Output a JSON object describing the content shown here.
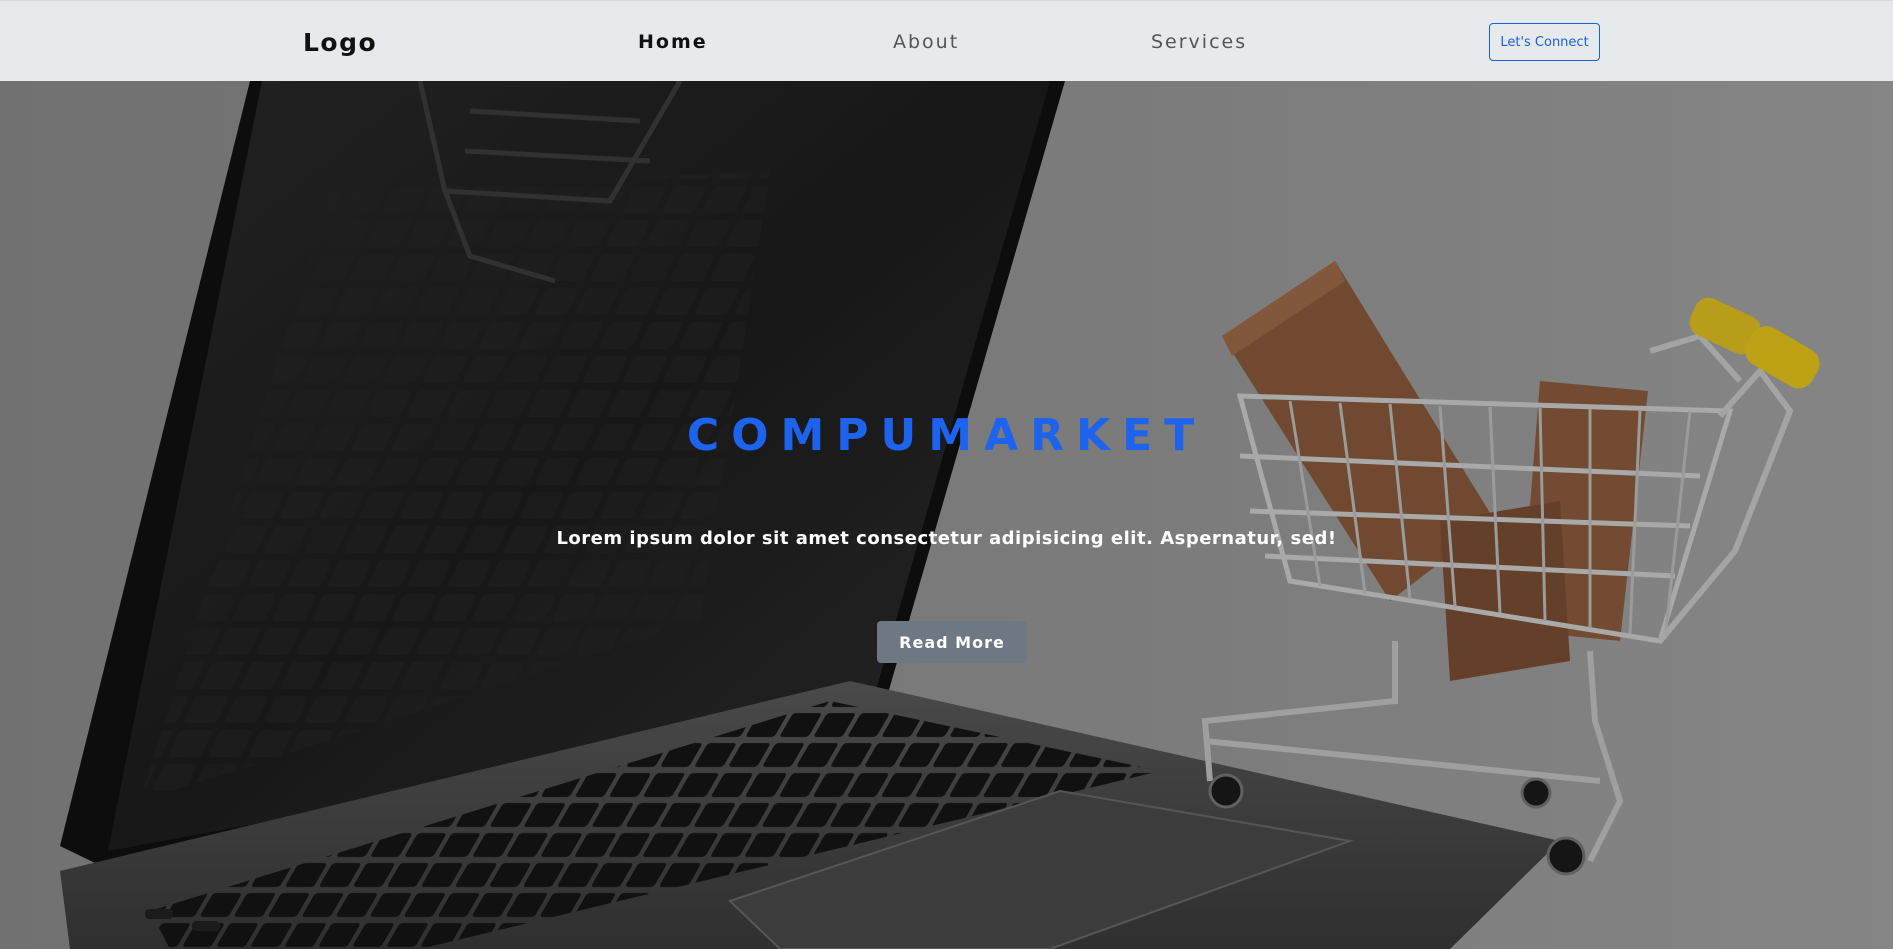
{
  "nav": {
    "logo": "Logo",
    "links": [
      "Home",
      "About",
      "Services"
    ],
    "cta_label": "Let's Connect"
  },
  "hero": {
    "title": "COMPUMARKET",
    "text": "Lorem ipsum dolor sit amet consectetur adipisicing elit. Aspernatur, sed!",
    "button_label": "Read More",
    "background_image": "laptop-shopping-cart-photo"
  },
  "colors": {
    "navbar_bg": "#e7eaed",
    "accent": "#1d63ee",
    "button_bg": "#6e7882",
    "overlay": "#8f8f8f"
  }
}
